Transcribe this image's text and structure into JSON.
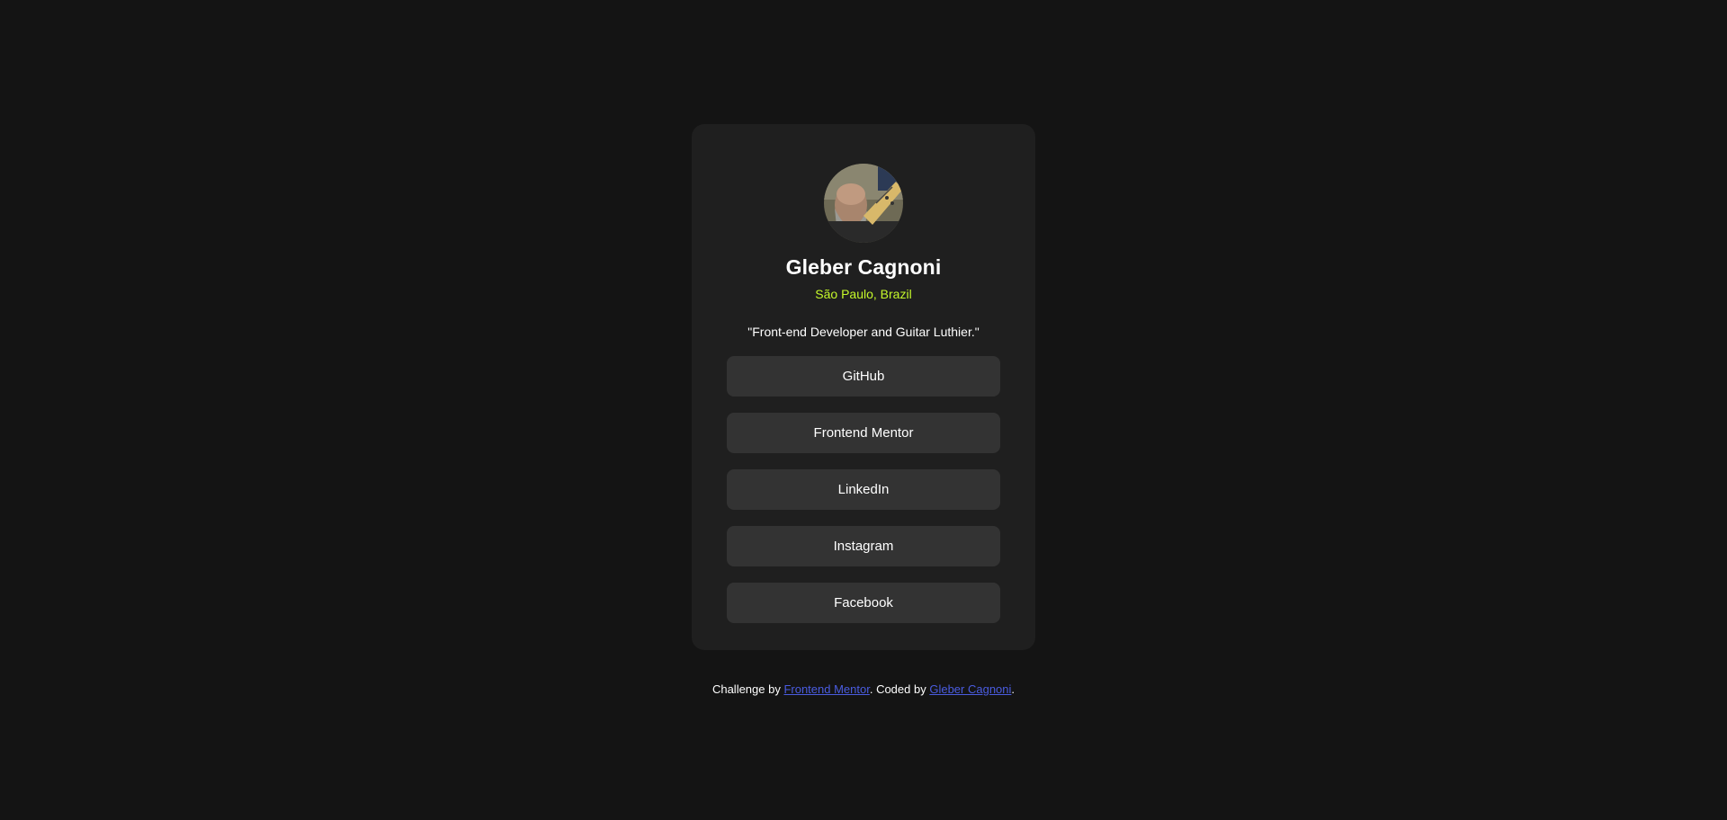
{
  "profile": {
    "name": "Gleber Cagnoni",
    "location": "São Paulo, Brazil",
    "bio": "\"Front-end Developer and Guitar Luthier.\"",
    "avatar_icon": "profile-photo-avatar"
  },
  "links": [
    {
      "label": "GitHub"
    },
    {
      "label": "Frontend Mentor"
    },
    {
      "label": "LinkedIn"
    },
    {
      "label": "Instagram"
    },
    {
      "label": "Facebook"
    }
  ],
  "attribution": {
    "prefix": "Challenge by ",
    "challenge_link": "Frontend Mentor",
    "middle": ". Coded by ",
    "author_link": "Gleber Cagnoni",
    "suffix": "."
  },
  "colors": {
    "background": "#141414",
    "card": "#1f1f1f",
    "button": "#333333",
    "accent": "#c4f82a",
    "link": "#4a5ce0"
  }
}
